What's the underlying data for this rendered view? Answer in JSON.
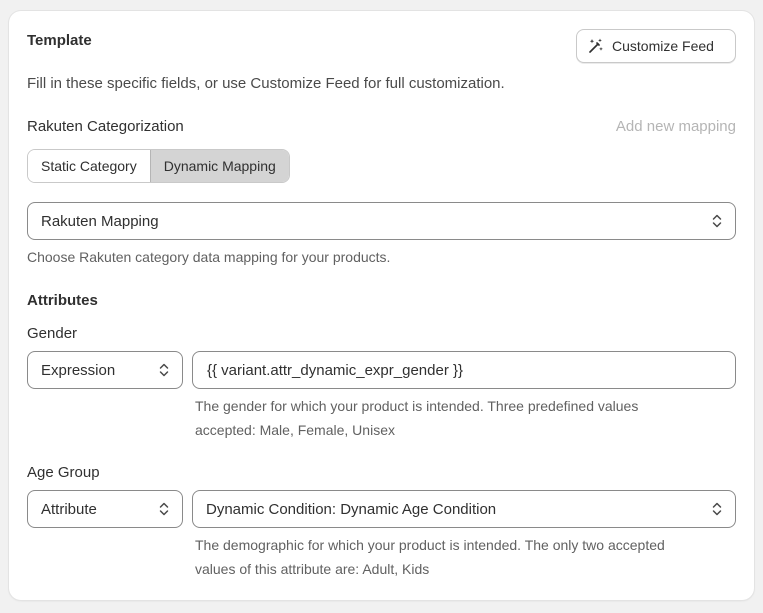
{
  "card": {
    "title": "Template",
    "customize_button": "Customize Feed",
    "description": "Fill in these specific fields, or use Customize Feed for full customization."
  },
  "categorization": {
    "label": "Rakuten Categorization",
    "add_mapping": "Add new mapping",
    "tabs": [
      "Static Category",
      "Dynamic Mapping"
    ],
    "active_tab": "Dynamic Mapping",
    "mapping_select": "Rakuten Mapping",
    "mapping_help": "Choose Rakuten category data mapping for your products."
  },
  "attributes": {
    "heading": "Attributes",
    "gender": {
      "label": "Gender",
      "type": "Expression",
      "value": "{{ variant.attr_dynamic_expr_gender }}",
      "help_line1": "The gender for which your product is intended. Three predefined values",
      "help_line2": "accepted: Male, Female, Unisex"
    },
    "age_group": {
      "label": "Age Group",
      "type": "Attribute",
      "value": "Dynamic Condition: Dynamic Age Condition",
      "help_line1": "The demographic for which your product is intended. The only two accepted",
      "help_line2": "values of this attribute are: Adult, Kids"
    }
  },
  "icons": {
    "customize": "magic-wand-icon",
    "select": "chevron-up-down-icon"
  }
}
